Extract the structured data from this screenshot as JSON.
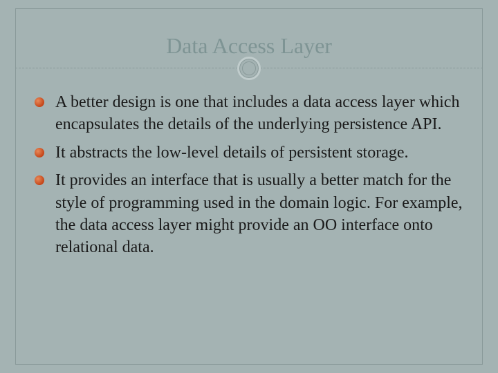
{
  "slide": {
    "title": "Data Access Layer",
    "bullets": [
      "A better design is one that includes a data access layer which encapsulates the details of the underlying persistence API.",
      "It abstracts the low-level details of persistent storage.",
      "It provides an interface that is usually a better match for the style of programming used in the domain logic. For example, the data access layer might provide an OO interface onto relational data."
    ]
  }
}
